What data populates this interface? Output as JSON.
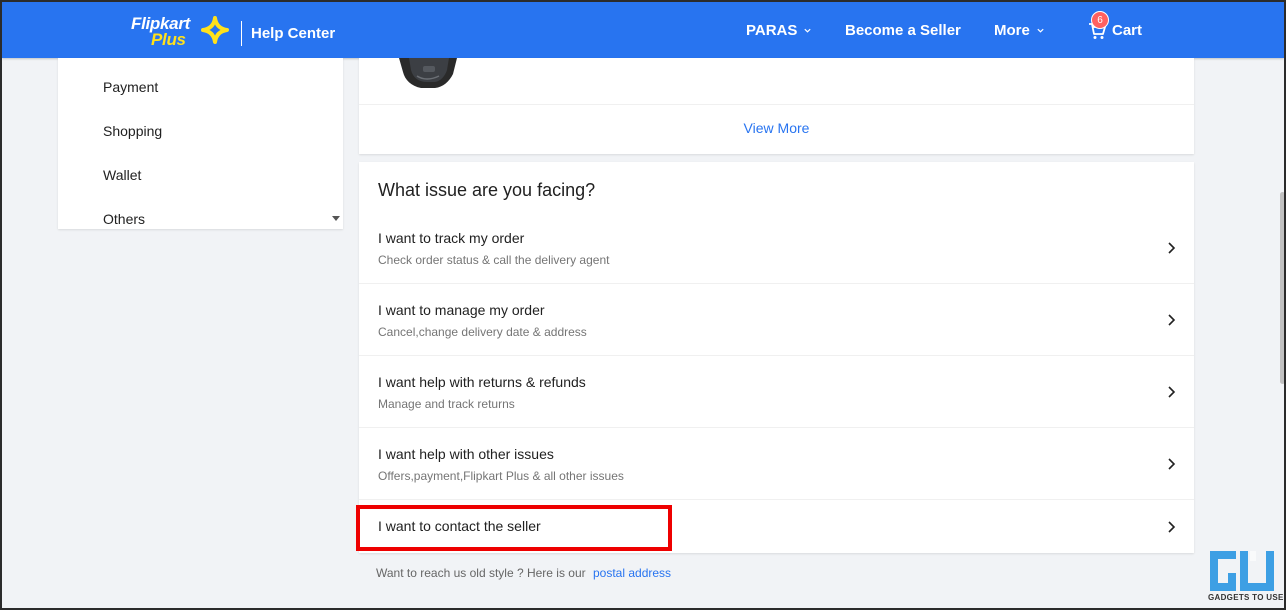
{
  "header": {
    "logo_top": "Flipkart",
    "logo_bottom": "Plus",
    "help_center": "Help Center",
    "user_label": "PARAS",
    "seller_label": "Become a Seller",
    "more_label": "More",
    "cart_label": "Cart",
    "cart_count": "6",
    "colors": {
      "brand": "#2874f0",
      "plus_yellow": "#ffe11b",
      "badge": "#ff6161"
    }
  },
  "sidebar": {
    "items": [
      {
        "label": "Payment"
      },
      {
        "label": "Shopping"
      },
      {
        "label": "Wallet"
      },
      {
        "label": "Others"
      }
    ]
  },
  "recent": {
    "view_more": "View More"
  },
  "issues": {
    "title": "What issue are you facing?",
    "items": [
      {
        "title": "I want to track my order",
        "subtitle": "Check order status & call the delivery agent"
      },
      {
        "title": "I want to manage my order",
        "subtitle": "Cancel,change delivery date & address"
      },
      {
        "title": "I want help with returns & refunds",
        "subtitle": "Manage and track returns"
      },
      {
        "title": "I want help with other issues",
        "subtitle": "Offers,payment,Flipkart Plus & all other issues"
      },
      {
        "title": "I want to contact the seller",
        "subtitle": ""
      }
    ],
    "highlight_color": "#ee0000"
  },
  "footer": {
    "text": "Want to reach us old style ? Here is our",
    "link": "postal address"
  },
  "watermark": {
    "text": "GADGETS TO USE"
  }
}
